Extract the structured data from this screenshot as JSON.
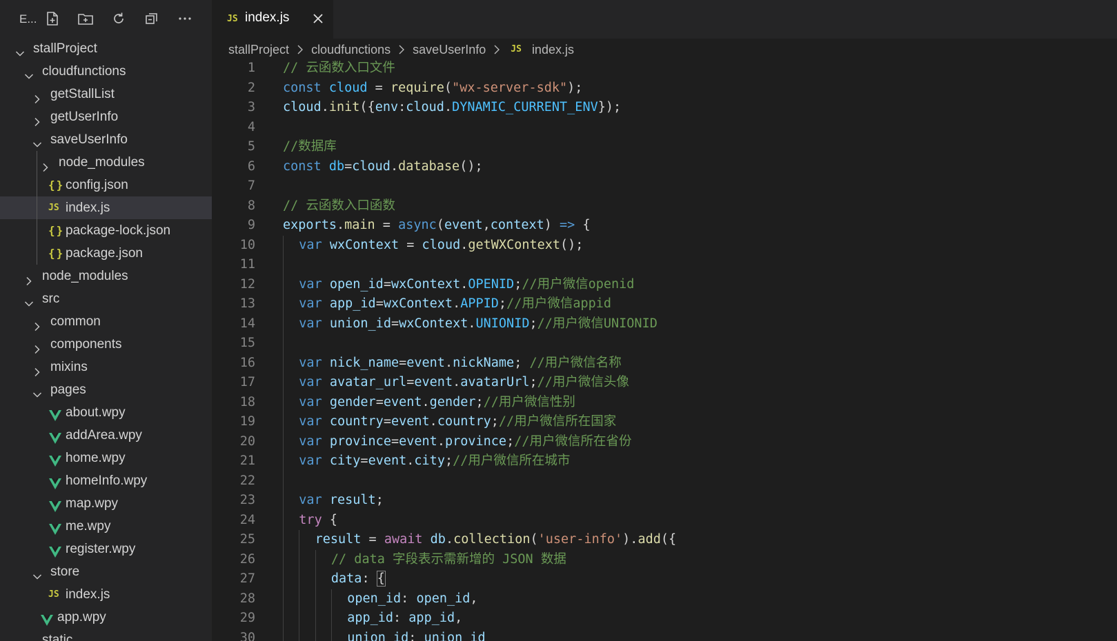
{
  "explorer": {
    "title": "E...",
    "toolbar": [
      {
        "name": "new-file-icon"
      },
      {
        "name": "new-folder-icon"
      },
      {
        "name": "refresh-icon"
      },
      {
        "name": "collapse-all-icon"
      },
      {
        "name": "more-icon"
      }
    ],
    "tree": [
      {
        "label": "stallProject",
        "depth": 0,
        "kind": "folder-open"
      },
      {
        "label": "cloudfunctions",
        "depth": 1,
        "kind": "folder-open"
      },
      {
        "label": "getStallList",
        "depth": 2,
        "kind": "folder"
      },
      {
        "label": "getUserInfo",
        "depth": 2,
        "kind": "folder"
      },
      {
        "label": "saveUserInfo",
        "depth": 2,
        "kind": "folder-open"
      },
      {
        "label": "node_modules",
        "depth": 3,
        "kind": "folder"
      },
      {
        "label": "config.json",
        "depth": 3,
        "kind": "json"
      },
      {
        "label": "index.js",
        "depth": 3,
        "kind": "js",
        "selected": true
      },
      {
        "label": "package-lock.json",
        "depth": 3,
        "kind": "json"
      },
      {
        "label": "package.json",
        "depth": 3,
        "kind": "json"
      },
      {
        "label": "node_modules",
        "depth": 1,
        "kind": "folder"
      },
      {
        "label": "src",
        "depth": 1,
        "kind": "folder-open"
      },
      {
        "label": "common",
        "depth": 2,
        "kind": "folder"
      },
      {
        "label": "components",
        "depth": 2,
        "kind": "folder"
      },
      {
        "label": "mixins",
        "depth": 2,
        "kind": "folder"
      },
      {
        "label": "pages",
        "depth": 2,
        "kind": "folder-open"
      },
      {
        "label": "about.wpy",
        "depth": 3,
        "kind": "vue"
      },
      {
        "label": "addArea.wpy",
        "depth": 3,
        "kind": "vue"
      },
      {
        "label": "home.wpy",
        "depth": 3,
        "kind": "vue"
      },
      {
        "label": "homeInfo.wpy",
        "depth": 3,
        "kind": "vue"
      },
      {
        "label": "map.wpy",
        "depth": 3,
        "kind": "vue"
      },
      {
        "label": "me.wpy",
        "depth": 3,
        "kind": "vue"
      },
      {
        "label": "register.wpy",
        "depth": 3,
        "kind": "vue"
      },
      {
        "label": "store",
        "depth": 2,
        "kind": "folder-open"
      },
      {
        "label": "index.js",
        "depth": 3,
        "kind": "js"
      },
      {
        "label": "app.wpy",
        "depth": 2,
        "kind": "vue"
      },
      {
        "label": "static",
        "depth": 1,
        "kind": "folder"
      }
    ],
    "icons": {
      "json": "{}",
      "js": "JS"
    }
  },
  "tab": {
    "badge": "JS",
    "label": "index.js",
    "close_icon": "close-icon"
  },
  "breadcrumb": [
    "stallProject",
    "cloudfunctions",
    "saveUserInfo",
    "index.js"
  ],
  "breadcrumb_js_badge": "JS",
  "colors": {
    "keyword": "#569cd6",
    "control": "#c586c0",
    "variable": "#9cdcfe",
    "constant": "#4fc1ff",
    "function": "#dcdcaa",
    "string": "#ce9178",
    "comment": "#6a9955",
    "text": "#d4d4d4",
    "vue": "#41b883",
    "json": "#cbcb41"
  },
  "code": [
    {
      "n": "1",
      "indent": 0,
      "tokens": [
        [
          "cmt",
          "// 云函数入口文件"
        ]
      ]
    },
    {
      "n": "2",
      "indent": 0,
      "tokens": [
        [
          "k-decl",
          "const "
        ],
        [
          "const",
          "cloud"
        ],
        [
          "plain",
          " = "
        ],
        [
          "fn",
          "require"
        ],
        [
          "plain",
          "("
        ],
        [
          "str",
          "\"wx-server-sdk\""
        ],
        [
          "plain",
          ");"
        ]
      ]
    },
    {
      "n": "3",
      "indent": 0,
      "tokens": [
        [
          "var",
          "cloud"
        ],
        [
          "plain",
          "."
        ],
        [
          "fn",
          "init"
        ],
        [
          "plain",
          "({"
        ],
        [
          "var",
          "env"
        ],
        [
          "plain",
          ":"
        ],
        [
          "var",
          "cloud"
        ],
        [
          "plain",
          "."
        ],
        [
          "const",
          "DYNAMIC_CURRENT_ENV"
        ],
        [
          "plain",
          "});"
        ]
      ]
    },
    {
      "n": "4",
      "indent": 0,
      "tokens": []
    },
    {
      "n": "5",
      "indent": 0,
      "tokens": [
        [
          "cmt",
          "//数据库"
        ]
      ]
    },
    {
      "n": "6",
      "indent": 0,
      "tokens": [
        [
          "k-decl",
          "const "
        ],
        [
          "const",
          "db"
        ],
        [
          "plain",
          "="
        ],
        [
          "var",
          "cloud"
        ],
        [
          "plain",
          "."
        ],
        [
          "fn",
          "database"
        ],
        [
          "plain",
          "();"
        ]
      ]
    },
    {
      "n": "7",
      "indent": 0,
      "tokens": []
    },
    {
      "n": "8",
      "indent": 0,
      "tokens": [
        [
          "cmt",
          "// 云函数入口函数"
        ]
      ]
    },
    {
      "n": "9",
      "indent": 0,
      "tokens": [
        [
          "var",
          "exports"
        ],
        [
          "plain",
          "."
        ],
        [
          "fn",
          "main"
        ],
        [
          "plain",
          " = "
        ],
        [
          "k-decl",
          "async"
        ],
        [
          "plain",
          "("
        ],
        [
          "var",
          "event"
        ],
        [
          "plain",
          ","
        ],
        [
          "var",
          "context"
        ],
        [
          "plain",
          ") "
        ],
        [
          "k-decl",
          "=>"
        ],
        [
          "plain",
          " {"
        ]
      ]
    },
    {
      "n": "10",
      "indent": 1,
      "tokens": [
        [
          "k-decl",
          "var "
        ],
        [
          "var",
          "wxContext"
        ],
        [
          "plain",
          " = "
        ],
        [
          "var",
          "cloud"
        ],
        [
          "plain",
          "."
        ],
        [
          "fn",
          "getWXContext"
        ],
        [
          "plain",
          "();"
        ]
      ]
    },
    {
      "n": "11",
      "indent": 1,
      "tokens": []
    },
    {
      "n": "12",
      "indent": 1,
      "tokens": [
        [
          "k-decl",
          "var "
        ],
        [
          "var",
          "open_id"
        ],
        [
          "plain",
          "="
        ],
        [
          "var",
          "wxContext"
        ],
        [
          "plain",
          "."
        ],
        [
          "const",
          "OPENID"
        ],
        [
          "plain",
          ";"
        ],
        [
          "cmt",
          "//用户微信openid"
        ]
      ]
    },
    {
      "n": "13",
      "indent": 1,
      "tokens": [
        [
          "k-decl",
          "var "
        ],
        [
          "var",
          "app_id"
        ],
        [
          "plain",
          "="
        ],
        [
          "var",
          "wxContext"
        ],
        [
          "plain",
          "."
        ],
        [
          "const",
          "APPID"
        ],
        [
          "plain",
          ";"
        ],
        [
          "cmt",
          "//用户微信appid"
        ]
      ]
    },
    {
      "n": "14",
      "indent": 1,
      "tokens": [
        [
          "k-decl",
          "var "
        ],
        [
          "var",
          "union_id"
        ],
        [
          "plain",
          "="
        ],
        [
          "var",
          "wxContext"
        ],
        [
          "plain",
          "."
        ],
        [
          "const",
          "UNIONID"
        ],
        [
          "plain",
          ";"
        ],
        [
          "cmt",
          "//用户微信UNIONID"
        ]
      ]
    },
    {
      "n": "15",
      "indent": 1,
      "tokens": []
    },
    {
      "n": "16",
      "indent": 1,
      "tokens": [
        [
          "k-decl",
          "var "
        ],
        [
          "var",
          "nick_name"
        ],
        [
          "plain",
          "="
        ],
        [
          "var",
          "event"
        ],
        [
          "plain",
          "."
        ],
        [
          "var",
          "nickName"
        ],
        [
          "plain",
          "; "
        ],
        [
          "cmt",
          "//用户微信名称"
        ]
      ]
    },
    {
      "n": "17",
      "indent": 1,
      "tokens": [
        [
          "k-decl",
          "var "
        ],
        [
          "var",
          "avatar_url"
        ],
        [
          "plain",
          "="
        ],
        [
          "var",
          "event"
        ],
        [
          "plain",
          "."
        ],
        [
          "var",
          "avatarUrl"
        ],
        [
          "plain",
          ";"
        ],
        [
          "cmt",
          "//用户微信头像"
        ]
      ]
    },
    {
      "n": "18",
      "indent": 1,
      "tokens": [
        [
          "k-decl",
          "var "
        ],
        [
          "var",
          "gender"
        ],
        [
          "plain",
          "="
        ],
        [
          "var",
          "event"
        ],
        [
          "plain",
          "."
        ],
        [
          "var",
          "gender"
        ],
        [
          "plain",
          ";"
        ],
        [
          "cmt",
          "//用户微信性别"
        ]
      ]
    },
    {
      "n": "19",
      "indent": 1,
      "tokens": [
        [
          "k-decl",
          "var "
        ],
        [
          "var",
          "country"
        ],
        [
          "plain",
          "="
        ],
        [
          "var",
          "event"
        ],
        [
          "plain",
          "."
        ],
        [
          "var",
          "country"
        ],
        [
          "plain",
          ";"
        ],
        [
          "cmt",
          "//用户微信所在国家"
        ]
      ]
    },
    {
      "n": "20",
      "indent": 1,
      "tokens": [
        [
          "k-decl",
          "var "
        ],
        [
          "var",
          "province"
        ],
        [
          "plain",
          "="
        ],
        [
          "var",
          "event"
        ],
        [
          "plain",
          "."
        ],
        [
          "var",
          "province"
        ],
        [
          "plain",
          ";"
        ],
        [
          "cmt",
          "//用户微信所在省份"
        ]
      ]
    },
    {
      "n": "21",
      "indent": 1,
      "tokens": [
        [
          "k-decl",
          "var "
        ],
        [
          "var",
          "city"
        ],
        [
          "plain",
          "="
        ],
        [
          "var",
          "event"
        ],
        [
          "plain",
          "."
        ],
        [
          "var",
          "city"
        ],
        [
          "plain",
          ";"
        ],
        [
          "cmt",
          "//用户微信所在城市"
        ]
      ]
    },
    {
      "n": "22",
      "indent": 1,
      "tokens": []
    },
    {
      "n": "23",
      "indent": 1,
      "tokens": [
        [
          "k-decl",
          "var "
        ],
        [
          "var",
          "result"
        ],
        [
          "plain",
          ";"
        ]
      ]
    },
    {
      "n": "24",
      "indent": 1,
      "tokens": [
        [
          "k-ctrl",
          "try"
        ],
        [
          "plain",
          " {"
        ]
      ]
    },
    {
      "n": "25",
      "indent": 2,
      "tokens": [
        [
          "var",
          "result"
        ],
        [
          "plain",
          " = "
        ],
        [
          "k-ctrl",
          "await "
        ],
        [
          "var",
          "db"
        ],
        [
          "plain",
          "."
        ],
        [
          "fn",
          "collection"
        ],
        [
          "plain",
          "("
        ],
        [
          "str",
          "'user-info'"
        ],
        [
          "plain",
          ")."
        ],
        [
          "fn",
          "add"
        ],
        [
          "plain",
          "({"
        ]
      ]
    },
    {
      "n": "26",
      "indent": 3,
      "tokens": [
        [
          "cmt",
          "// data 字段表示需新增的 JSON 数据"
        ]
      ]
    },
    {
      "n": "27",
      "indent": 3,
      "tokens": [
        [
          "var",
          "data"
        ],
        [
          "plain",
          ": "
        ],
        [
          "bracket",
          "{"
        ]
      ]
    },
    {
      "n": "28",
      "indent": 4,
      "tokens": [
        [
          "var",
          "open_id"
        ],
        [
          "plain",
          ": "
        ],
        [
          "var",
          "open_id"
        ],
        [
          "plain",
          ","
        ]
      ]
    },
    {
      "n": "29",
      "indent": 4,
      "tokens": [
        [
          "var",
          "app_id"
        ],
        [
          "plain",
          ": "
        ],
        [
          "var",
          "app_id"
        ],
        [
          "plain",
          ","
        ]
      ]
    },
    {
      "n": "30",
      "indent": 4,
      "tokens": [
        [
          "var",
          "union_id"
        ],
        [
          "plain",
          ": "
        ],
        [
          "var",
          "union_id"
        ]
      ]
    }
  ]
}
